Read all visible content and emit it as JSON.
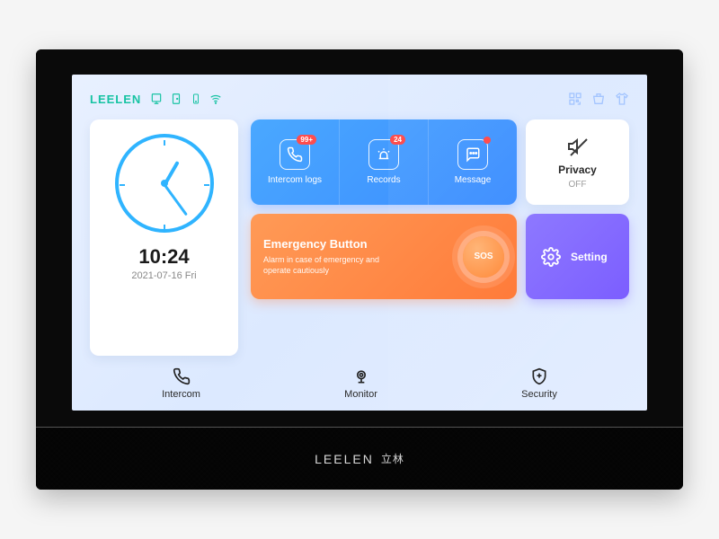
{
  "brand": {
    "logo": "LEELEN",
    "logo_cn": "立林"
  },
  "clock": {
    "time": "10:24",
    "date": "2021-07-16 Fri"
  },
  "tiles": {
    "intercom_logs": {
      "label": "Intercom logs",
      "badge": "99+"
    },
    "records": {
      "label": "Records",
      "badge": "24"
    },
    "message": {
      "label": "Message",
      "badge": ""
    }
  },
  "privacy": {
    "title": "Privacy",
    "state": "OFF"
  },
  "emergency": {
    "title": "Emergency Button",
    "desc": "Alarm in case of emergency and operate cautiously",
    "sos": "SOS"
  },
  "setting": {
    "label": "Setting"
  },
  "nav": {
    "intercom": "Intercom",
    "monitor": "Monitor",
    "security": "Security"
  }
}
